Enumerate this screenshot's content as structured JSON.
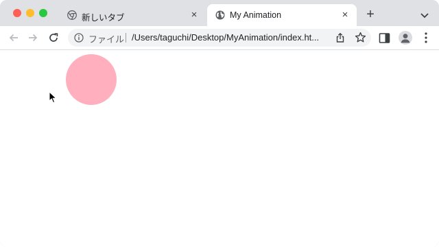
{
  "window": {
    "controls": [
      "close",
      "minimize",
      "zoom"
    ]
  },
  "tabs": [
    {
      "title": "新しいタブ",
      "favicon": "chrome-icon",
      "active": false
    },
    {
      "title": "My Animation",
      "favicon": "globe-icon",
      "active": true
    }
  ],
  "tabstrip": {
    "close_label": "×",
    "new_tab_label": "+"
  },
  "omnibox": {
    "scheme_label": "ファイル",
    "url": "/Users/taguchi/Desktop/MyAnimation/index.ht..."
  },
  "page": {
    "ball_color": "#ffafbd"
  }
}
